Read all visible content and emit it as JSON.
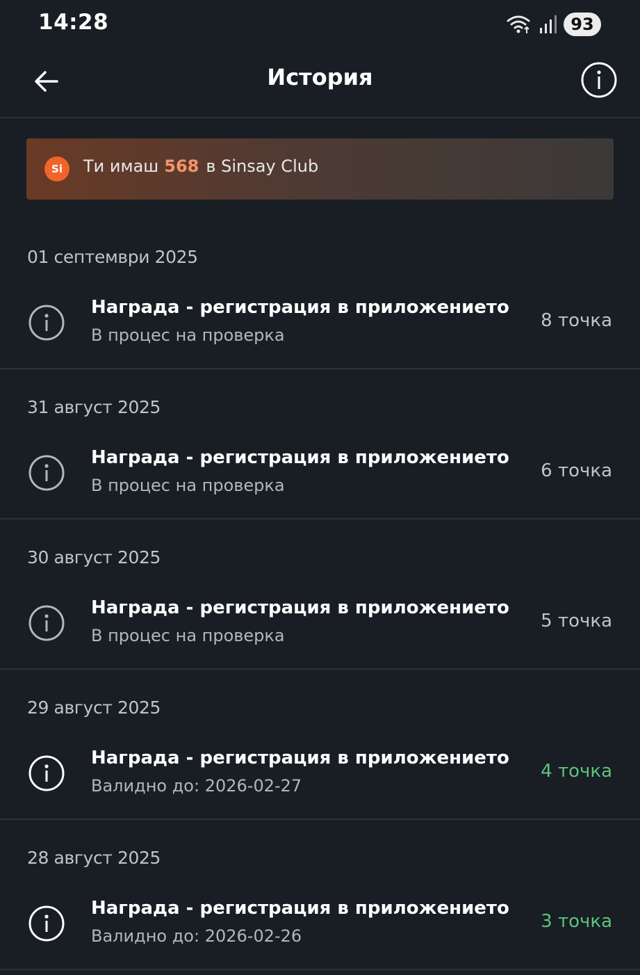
{
  "status_bar": {
    "time": "14:28",
    "battery": "93",
    "icons": [
      "wifi-icon",
      "signal-icon"
    ]
  },
  "header": {
    "title": "История",
    "back_icon": "arrow-left-icon",
    "info_icon": "info-circle-icon"
  },
  "banner": {
    "prefix": "Ти имаш",
    "points": "568",
    "suffix": "в Sinsay Club",
    "logo_text": "Si",
    "accent": "#f0642a"
  },
  "entries": [
    {
      "date": "01 септември 2025",
      "title": "Награда - регистрация в приложението",
      "subtitle": "В процес на проверка",
      "points": "8 точка",
      "status": "pending"
    },
    {
      "date": "31 август 2025",
      "title": "Награда - регистрация в приложението",
      "subtitle": "В процес на проверка",
      "points": "6 точка",
      "status": "pending"
    },
    {
      "date": "30 август 2025",
      "title": "Награда - регистрация в приложението",
      "subtitle": "В процес на проверка",
      "points": "5 точка",
      "status": "pending"
    },
    {
      "date": "29 август 2025",
      "title": "Награда - регистрация в приложението",
      "subtitle": "Валидно до: 2026-02-27",
      "points": "4 точка",
      "status": "valid"
    },
    {
      "date": "28 август 2025",
      "title": "Награда - регистрация в приложението",
      "subtitle": "Валидно до: 2026-02-26",
      "points": "3 точка",
      "status": "valid"
    }
  ],
  "colors": {
    "background": "#181e24",
    "pending_points": "#c1c4c7",
    "valid_points": "#5ec27f"
  }
}
